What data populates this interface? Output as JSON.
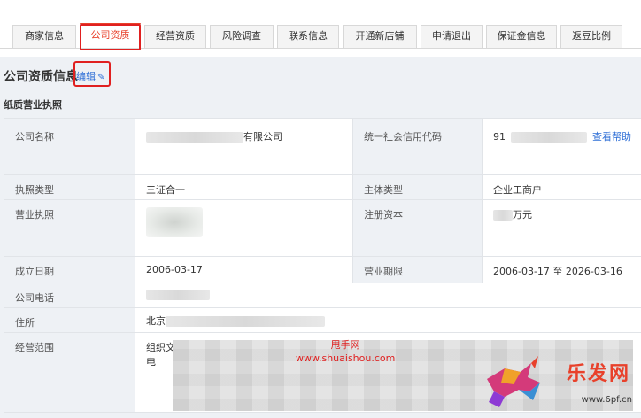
{
  "header": {
    "breadcrumb": ""
  },
  "tabs": [
    {
      "label": "商家信息",
      "active": false
    },
    {
      "label": "公司资质",
      "active": true
    },
    {
      "label": "经营资质",
      "active": false
    },
    {
      "label": "风险调查",
      "active": false
    },
    {
      "label": "联系信息",
      "active": false
    },
    {
      "label": "开通新店铺",
      "active": false
    },
    {
      "label": "申请退出",
      "active": false
    },
    {
      "label": "保证金信息",
      "active": false
    },
    {
      "label": "返豆比例",
      "active": false
    }
  ],
  "section": {
    "title": "公司资质信息",
    "edit_label": "编辑"
  },
  "subsection": {
    "title": "纸质营业执照"
  },
  "rows": {
    "company_name": {
      "label": "公司名称",
      "value_suffix": "有限公司"
    },
    "credit_code": {
      "label": "统一社会信用代码",
      "value_prefix": "91",
      "help": "查看帮助"
    },
    "license_type": {
      "label": "执照类型",
      "value": "三证合一"
    },
    "subject_type": {
      "label": "主体类型",
      "value": "企业工商户"
    },
    "license": {
      "label": "营业执照"
    },
    "registered_capital": {
      "label": "注册资本",
      "value_suffix": "万元"
    },
    "established": {
      "label": "成立日期",
      "value": "2006-03-17"
    },
    "business_term": {
      "label": "营业期限",
      "value": "2006-03-17 至 2026-03-16"
    },
    "phone": {
      "label": "公司电话"
    },
    "address": {
      "label": "住所",
      "value_prefix": "北京"
    },
    "scope": {
      "label": "经营范围",
      "value_line1": "组织文化",
      "value_line2": "电"
    }
  },
  "watermark": {
    "name": "甩手网",
    "url": "www.shuaishou.com"
  },
  "logo": {
    "text": "乐发网",
    "url": "www.6pf.cn"
  },
  "colors": {
    "accent": "#e8412b",
    "link": "#2f6fd6",
    "highlight": "#e02020"
  }
}
